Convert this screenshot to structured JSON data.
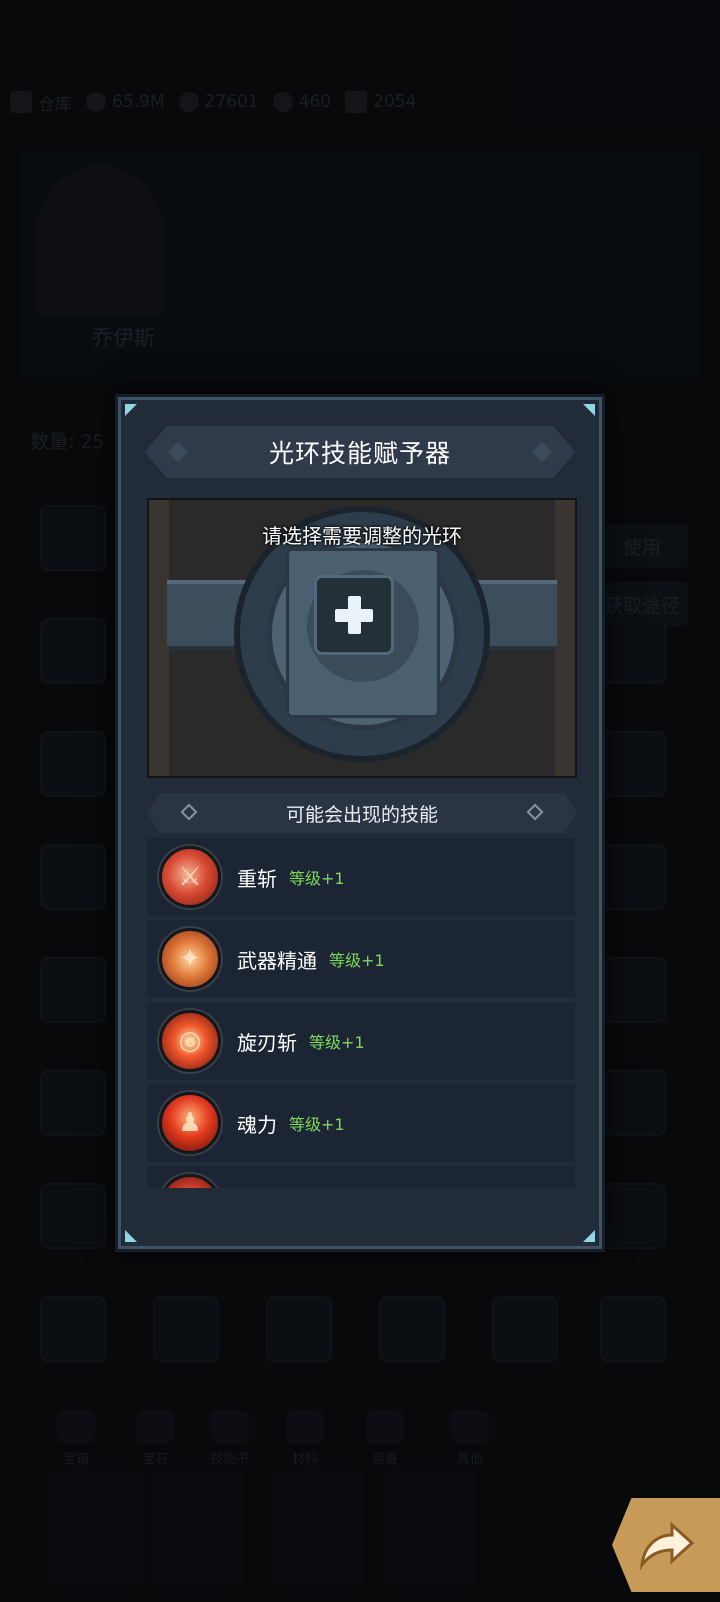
{
  "background": {
    "topbar": {
      "label": "仓库",
      "gold": "65.9M",
      "gems": "27601",
      "energy": "460",
      "tickets": "2054"
    },
    "hero_name": "乔伊斯",
    "count_label": "数量: 25",
    "side_buttons": [
      "使用",
      "获取途径"
    ],
    "category_tabs": [
      "宝箱",
      "宝石",
      "技能书",
      "材料",
      "装备",
      "其他"
    ]
  },
  "modal": {
    "title": "光环技能赋予器",
    "hint": "请选择需要调整的光环",
    "subtitle": "可能会出现的技能",
    "skills": [
      {
        "name": "重斩",
        "level": "等级+1",
        "icon": "heavy-slash-icon"
      },
      {
        "name": "武器精通",
        "level": "等级+1",
        "icon": "weapon-mastery-icon"
      },
      {
        "name": "旋刃斩",
        "level": "等级+1",
        "icon": "spin-blade-icon"
      },
      {
        "name": "魂力",
        "level": "等级+1",
        "icon": "soul-power-icon"
      }
    ]
  },
  "colors": {
    "modal_bg": "#222c39",
    "level_green": "#7ed957",
    "accent_orange": "#d39a52"
  }
}
